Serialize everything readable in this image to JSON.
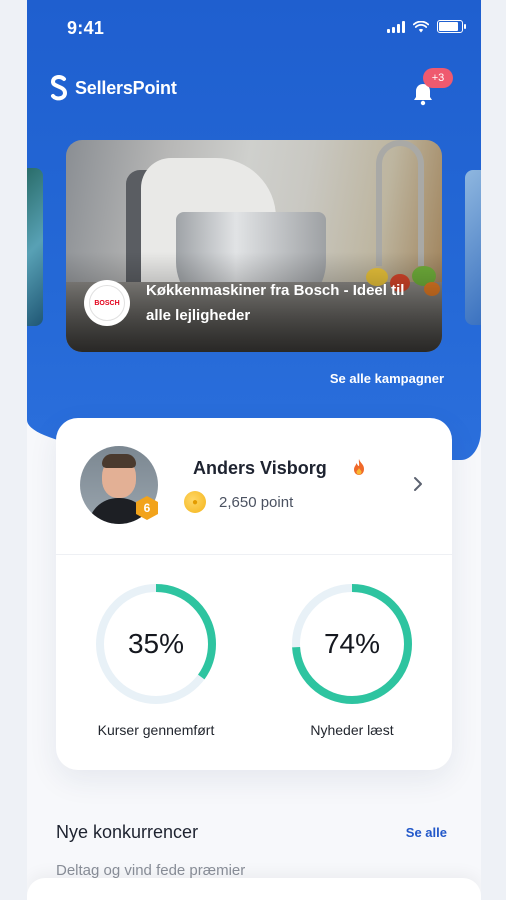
{
  "status_bar": {
    "time": "9:41"
  },
  "brand": {
    "name": "SellersPoint"
  },
  "notifications": {
    "badge": "+3"
  },
  "campaign": {
    "brand_logo_text": "BOSCH",
    "title": "Køkkenmaskiner fra Bosch - Ideel til alle lejligheder"
  },
  "see_all_campaigns": "Se alle kampagner",
  "profile": {
    "name": "Anders Visborg",
    "level": "6",
    "points": "2,650 point"
  },
  "stats": [
    {
      "value": "35%",
      "label": "Kurser gennemført",
      "progress": 0.35
    },
    {
      "value": "74%",
      "label": "Nyheder læst",
      "progress": 0.74
    }
  ],
  "competitions": {
    "title": "Nye konkurrencer",
    "see_all": "Se alle",
    "subtitle": "Deltag og vind fede præmier"
  },
  "colors": {
    "primary": "#2468d6",
    "accent": "#2ec4a0",
    "badge": "#ef5a6f",
    "ring_track": "#e8f1f7"
  }
}
